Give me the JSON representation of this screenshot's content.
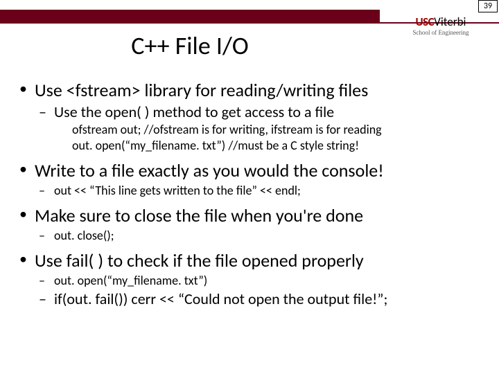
{
  "page_number": "39",
  "logo": {
    "usc": "USC",
    "viterbi": "Viterbi",
    "sub": "School of Engineering"
  },
  "title": "C++ File I/O",
  "bullets": {
    "b1": "Use <fstream> library for reading/writing files",
    "b1_1": "Use the open( ) method to get access to a file",
    "b1_1_1": "ofstream out; //ofstream is for writing, ifstream is for reading",
    "b1_1_2": "out. open(“my_filename. txt”) //must be a C style string!",
    "b2": "Write to a file exactly as you would the console!",
    "b2_1": "out << “This line gets written to the file” << endl;",
    "b3": "Make sure to close the file when you're done",
    "b3_1": "out. close();",
    "b4": "Use fail( ) to check if the file opened properly",
    "b4_1": "out. open(“my_filename. txt”)",
    "b4_2": "if(out. fail()) cerr << “Could not open the output file!”;"
  }
}
